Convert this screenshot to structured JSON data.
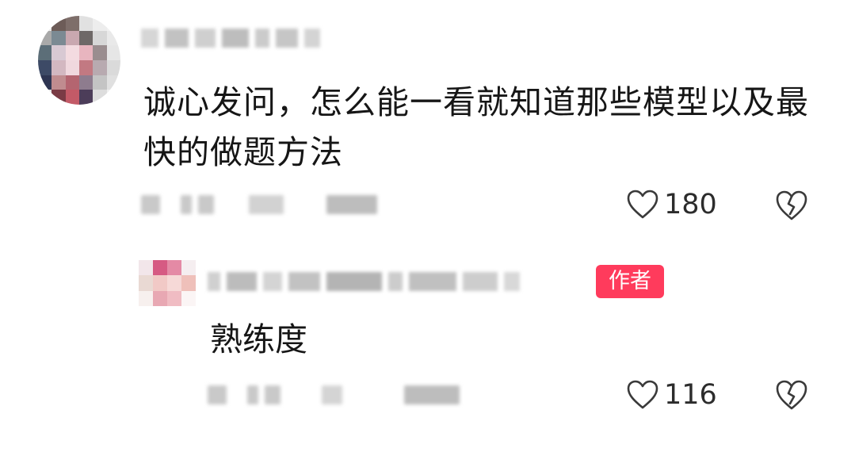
{
  "comment": {
    "text": "诚心发问，怎么能一看就知道那些模型以及最快的做题方法",
    "likes": "180"
  },
  "reply": {
    "badge": "作者",
    "text": "熟练度",
    "likes": "116"
  },
  "icons": {
    "like": "heart-outline-icon",
    "dislike": "broken-heart-icon"
  },
  "colors": {
    "badge_bg": "#ff3b5c",
    "text": "#161616"
  }
}
